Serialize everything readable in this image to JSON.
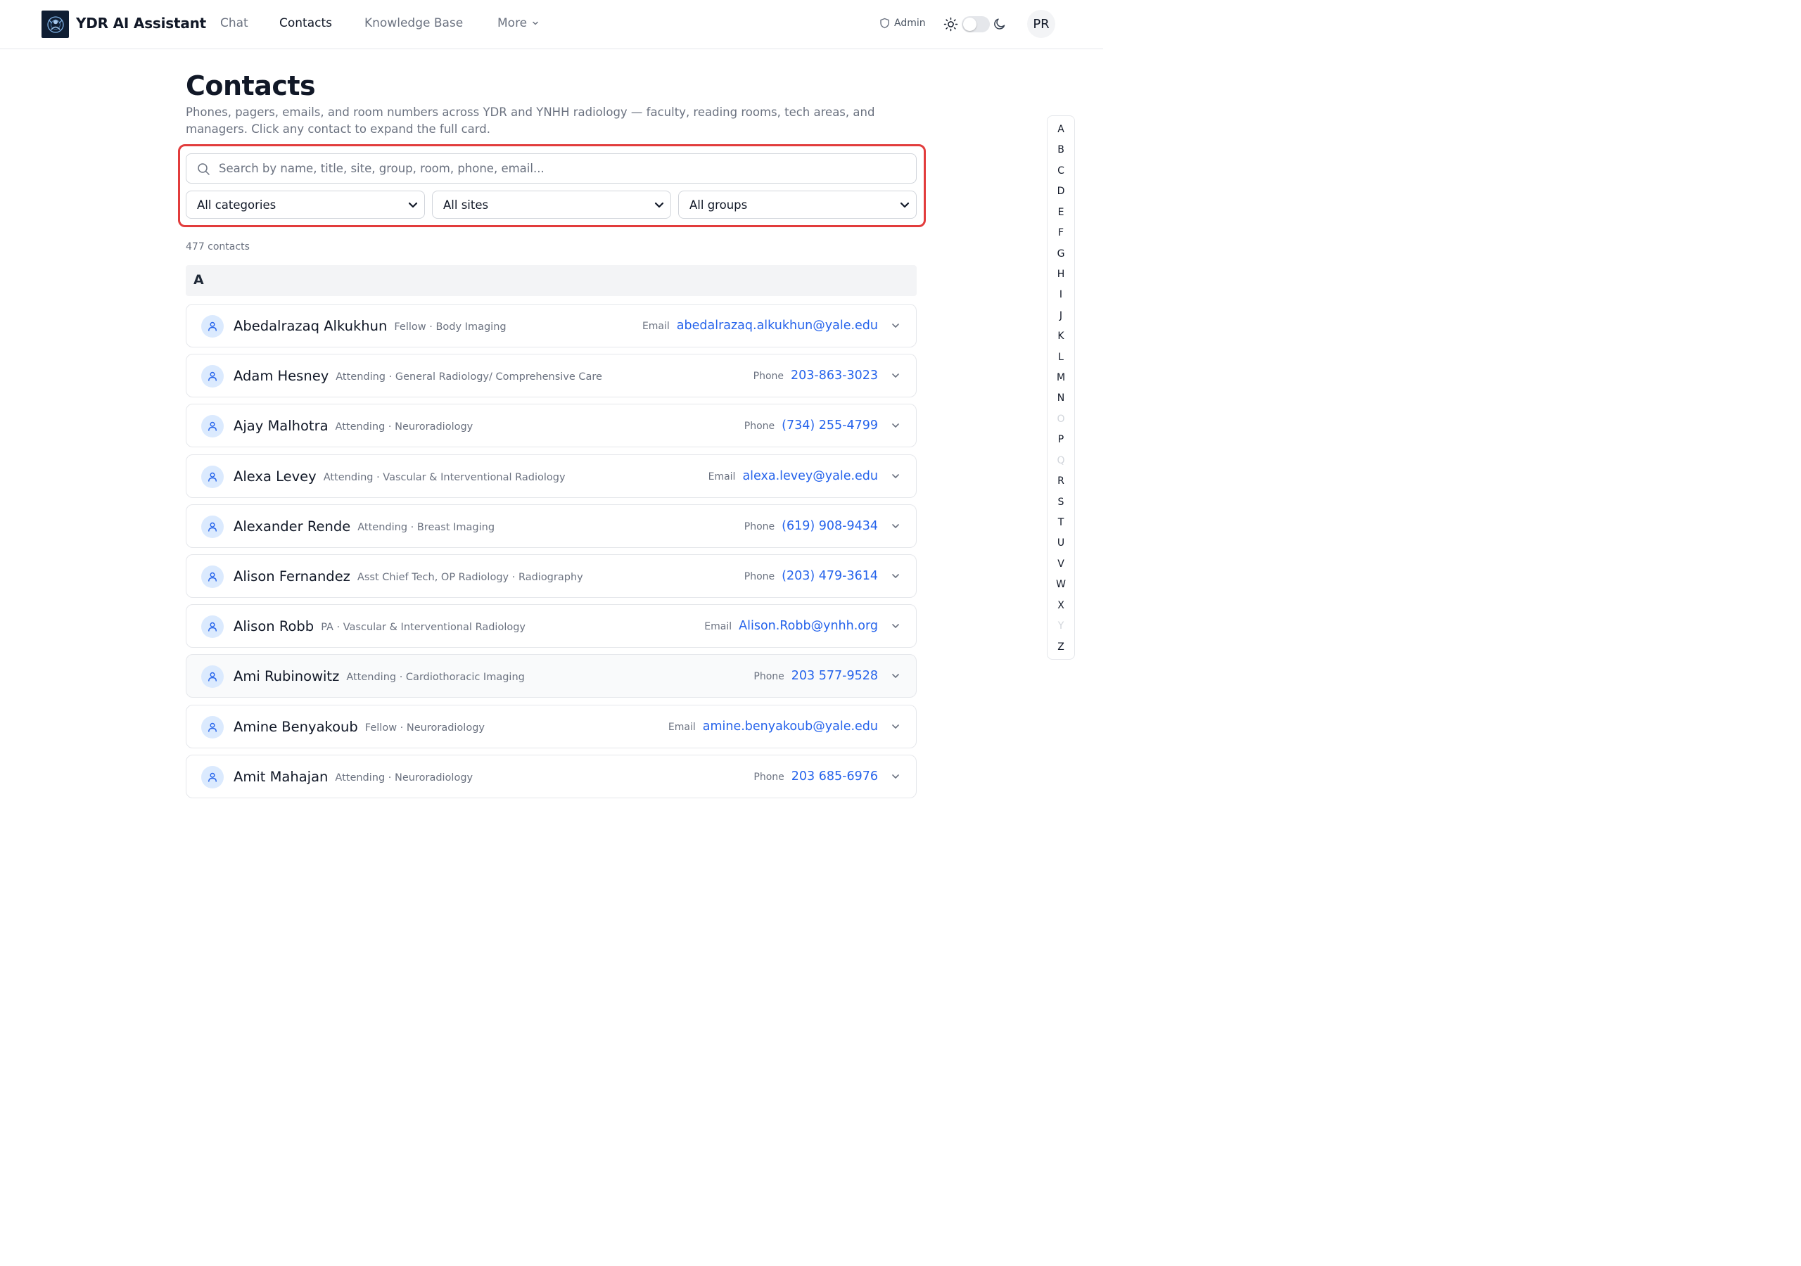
{
  "header": {
    "app_title": "YDR AI Assistant",
    "nav": {
      "chat": "Chat",
      "contacts": "Contacts",
      "knowledge_base": "Knowledge Base",
      "more": "More"
    },
    "active_nav": "Contacts",
    "admin": "Admin",
    "theme_toggle": "light",
    "avatar_initials": "PR"
  },
  "page": {
    "title": "Contacts",
    "description": "Phones, pagers, emails, and room numbers across YDR and YNHH radiology — faculty, reading rooms, tech areas, and managers. Click any contact to expand the full card."
  },
  "filters": {
    "search_placeholder": "Search by name, title, site, group, room, phone, email...",
    "search_value": "",
    "category": "All categories",
    "site": "All sites",
    "group": "All groups"
  },
  "results": {
    "count_text": "477 contacts",
    "section_letter": "A",
    "contacts": [
      {
        "name": "Abedalrazaq Alkukhun",
        "subtitle": "Fellow · Body Imaging",
        "label": "Email",
        "value": "abedalrazaq.alkukhun@yale.edu"
      },
      {
        "name": "Adam Hesney",
        "subtitle": "Attending · General Radiology/ Comprehensive Care",
        "label": "Phone",
        "value": "203-863-3023"
      },
      {
        "name": "Ajay Malhotra",
        "subtitle": "Attending · Neuroradiology",
        "label": "Phone",
        "value": "(734) 255-4799"
      },
      {
        "name": "Alexa Levey",
        "subtitle": "Attending · Vascular & Interventional Radiology",
        "label": "Email",
        "value": "alexa.levey@yale.edu"
      },
      {
        "name": "Alexander Rende",
        "subtitle": "Attending · Breast Imaging",
        "label": "Phone",
        "value": "(619) 908-9434"
      },
      {
        "name": "Alison Fernandez",
        "subtitle": "Asst Chief Tech, OP Radiology · Radiography",
        "label": "Phone",
        "value": "(203) 479-3614"
      },
      {
        "name": "Alison Robb",
        "subtitle": "PA · Vascular & Interventional Radiology",
        "label": "Email",
        "value": "Alison.Robb@ynhh.org"
      },
      {
        "name": "Ami Rubinowitz",
        "subtitle": "Attending · Cardiothoracic Imaging",
        "label": "Phone",
        "value": "203 577-9528"
      },
      {
        "name": "Amine Benyakoub",
        "subtitle": "Fellow · Neuroradiology",
        "label": "Email",
        "value": "amine.benyakoub@yale.edu"
      },
      {
        "name": "Amit Mahajan",
        "subtitle": "Attending · Neuroradiology",
        "label": "Phone",
        "value": "203 685-6976"
      }
    ]
  },
  "alphabet": {
    "letters": [
      "A",
      "B",
      "C",
      "D",
      "E",
      "F",
      "G",
      "H",
      "I",
      "J",
      "K",
      "L",
      "M",
      "N",
      "O",
      "P",
      "Q",
      "R",
      "S",
      "T",
      "U",
      "V",
      "W",
      "X",
      "Y",
      "Z"
    ],
    "disabled": [
      "O",
      "Q",
      "Y"
    ]
  },
  "colors": {
    "accent": "#2563eb",
    "highlight_border": "#e23c3c",
    "logo_bg": "#0f1e33",
    "avatar_bg": "#dbeafe"
  },
  "icons": {
    "logo": "radiology-logo-icon",
    "admin": "shield-icon",
    "light": "sun-icon",
    "dark": "moon-icon",
    "search": "search-icon",
    "contact": "user-icon",
    "expand": "chevron-down-icon"
  }
}
